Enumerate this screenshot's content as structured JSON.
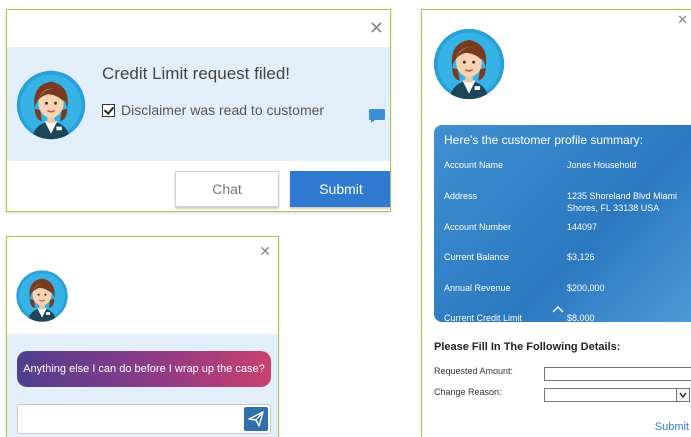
{
  "credit_panel": {
    "title": "Credit Limit request filed!",
    "disclaimer_label": "Disclaimer was read to customer",
    "disclaimer_checked": true,
    "chat_label": "Chat",
    "submit_label": "Submit",
    "close_glyph": "✕"
  },
  "chat_panel": {
    "message": "Anything else I can do before I wrap up the case?",
    "input_value": "",
    "close_glyph": "✕"
  },
  "profile_panel": {
    "close_glyph": "✕",
    "summary_title": "Here's the customer profile summary:",
    "rows": [
      {
        "label": "Account Name",
        "value": "Jones Household"
      },
      {
        "label": "Address",
        "value": "1235 Shoreland Blvd Miami Shores, FL 33138 USA"
      },
      {
        "label": "Account Number",
        "value": "144097"
      },
      {
        "label": "Current Balance",
        "value": "$3,126"
      },
      {
        "label": "Annual Revenue",
        "value": "$200,000"
      },
      {
        "label": "Current Credit Limit",
        "value": "$8,000"
      }
    ],
    "form_title": "Please Fill In The Following Details:",
    "requested_amount_label": "Requested Amount:",
    "requested_amount_value": "",
    "change_reason_label": "Change Reason:",
    "change_reason_value": "",
    "submit_label": "Submit"
  },
  "colors": {
    "accent": "#2f7ad0",
    "panel_border": "#a9c84a",
    "light_blue": "#e3eefb",
    "message_gradient_start": "#4f3e8e",
    "message_gradient_end": "#c9406f"
  }
}
